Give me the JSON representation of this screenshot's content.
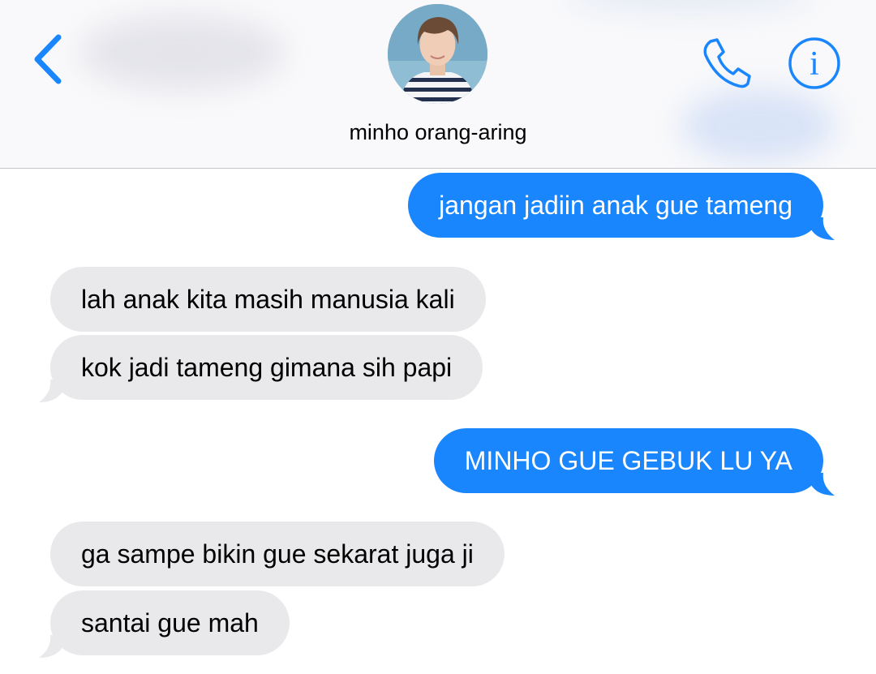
{
  "colors": {
    "accent": "#1a86fd",
    "outgoing_bubble": "#1a86fd",
    "incoming_bubble": "#e9e9eb",
    "header_bg": "#f9f9fb"
  },
  "header": {
    "back_icon": "chevron-left-icon",
    "contact_name": "minho orang-aring",
    "call_icon": "phone-icon",
    "info_icon": "info-icon",
    "info_glyph": "i"
  },
  "messages": [
    {
      "direction": "outgoing",
      "text": "jangan jadiin anak gue tameng"
    },
    {
      "direction": "incoming",
      "text": "lah anak kita masih manusia kali"
    },
    {
      "direction": "incoming",
      "text": "kok jadi tameng gimana sih papi"
    },
    {
      "direction": "outgoing",
      "text": "MINHO GUE GEBUK LU YA"
    },
    {
      "direction": "incoming",
      "text": "ga sampe bikin gue sekarat juga ji"
    },
    {
      "direction": "incoming",
      "text": "santai gue mah"
    }
  ]
}
